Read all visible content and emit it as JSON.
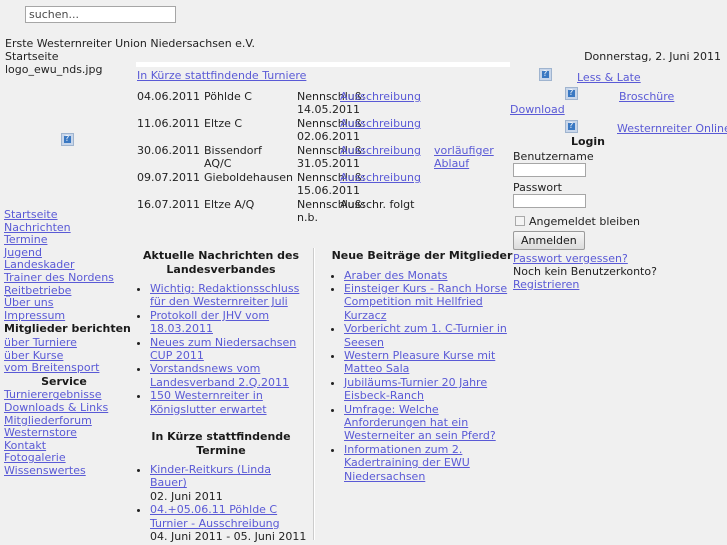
{
  "search": {
    "placeholder": "suchen...",
    "value": ""
  },
  "header": {
    "org_name": "Erste Westernreiter Union Niedersachsen e.V.",
    "breadcrumb": "Startseite",
    "logo_alt": "logo_ewu_nds.jpg",
    "date": "Donnerstag, 2. Juni 2011"
  },
  "tournaments": {
    "heading_link": "In Kürze stattfindende Turniere",
    "rows": [
      {
        "date": "04.06.2011",
        "place": "Pöhlde C",
        "nenn_label": "Nennschluß:",
        "nenn_date": "14.05.2011",
        "doc": "Ausschreibung",
        "extra": ""
      },
      {
        "date": "11.06.2011",
        "place": "Eltze C",
        "nenn_label": "Nennschluß:",
        "nenn_date": "02.06.2011",
        "doc": "Ausschreibung",
        "extra": ""
      },
      {
        "date": "30.06.2011",
        "place": "Bissendorf AQ/C",
        "nenn_label": "Nennschluß:",
        "nenn_date": "31.05.2011",
        "doc": "Ausschreibung",
        "extra": "vorläufiger Ablauf"
      },
      {
        "date": "09.07.2011",
        "place": "Gieboldehausen",
        "nenn_label": "Nennschluß:",
        "nenn_date": "15.06.2011",
        "doc": "Ausschreibung",
        "extra": ""
      },
      {
        "date": "16.07.2011",
        "place": "Eltze A/Q",
        "nenn_label": "Nennschluß:",
        "nenn_date": "n.b.",
        "doc": "Ausschr. folgt",
        "extra": ""
      }
    ]
  },
  "sidebar": {
    "items": [
      {
        "label": "Startseite",
        "type": "link"
      },
      {
        "label": "Nachrichten",
        "type": "link"
      },
      {
        "label": "Termine",
        "type": "link"
      },
      {
        "label": "Jugend",
        "type": "link"
      },
      {
        "label": "Landeskader",
        "type": "link"
      },
      {
        "label": "Trainer des Nordens",
        "type": "link"
      },
      {
        "label": "Reitbetriebe",
        "type": "link"
      },
      {
        "label": "Über uns",
        "type": "link"
      },
      {
        "label": "Impressum",
        "type": "link"
      },
      {
        "label": "Mitglieder berichten",
        "type": "header"
      },
      {
        "label": "über Turniere",
        "type": "link"
      },
      {
        "label": "über Kurse",
        "type": "link"
      },
      {
        "label": "vom Breitensport",
        "type": "link"
      },
      {
        "label": "Service",
        "type": "header-center"
      },
      {
        "label": "Turnierergebnisse",
        "type": "link"
      },
      {
        "label": "Downloads & Links",
        "type": "link"
      },
      {
        "label": "Mitgliederforum",
        "type": "link"
      },
      {
        "label": "Westernstore",
        "type": "link"
      },
      {
        "label": "Kontakt",
        "type": "link"
      },
      {
        "label": "Fotogalerie",
        "type": "link"
      },
      {
        "label": "Wissenswertes",
        "type": "link"
      }
    ]
  },
  "news_left": {
    "heading": "Aktuelle Nachrichten des Landesverbandes",
    "items": [
      "Wichtig: Redaktionsschluss für den Westernreiter Juli",
      "Protokoll der JHV vom 18.03.2011",
      "Neues zum Niedersachsen CUP 2011",
      "Vorstandsnews vom Landesverband 2.Q.2011",
      "150 Westernreiter in Königslutter erwartet"
    ]
  },
  "termine": {
    "heading": "In Kürze stattfindende Termine",
    "items": [
      {
        "title": "Kinder-Reitkurs (Linda Bauer)",
        "when": "02. Juni 2011"
      },
      {
        "title": "04.+05.06.11 Pöhlde C Turnier - Ausschreibung",
        "when": "04. Juni 2011 - 05. Juni 2011"
      }
    ]
  },
  "news_right": {
    "heading": "Neue Beiträge der Mitglieder",
    "items": [
      "Araber des Monats",
      "Einsteiger Kurs - Ranch Horse Competition mit Hellfried Kurzacz",
      "Vorbericht zum 1. C-Turnier in Seesen",
      "Western Pleasure Kurse mit Matteo Sala",
      "Jubiläums-Turnier 20 Jahre Eisbeck-Ranch",
      "Umfrage: Welche Anforderungen hat ein Westerneiter an sein Pferd?",
      "Informationen zum 2. Kadertraining der EWU Niedersachsen"
    ]
  },
  "banners": {
    "link1": "Less & Late",
    "link2": "Broschüre",
    "download": "Download",
    "link3": "Westernreiter Online"
  },
  "login": {
    "heading": "Login",
    "username_label": "Benutzername",
    "username_value": "",
    "password_label": "Passwort",
    "password_value": "",
    "remember_label": "Angemeldet bleiben",
    "submit_label": "Anmelden",
    "forgot_label": "Passwort vergessen?",
    "no_account_text": "Noch kein Benutzerkonto?",
    "register_label": "Registrieren"
  },
  "colors": {
    "link": "#5a5ad6",
    "background": "#f0f0f0",
    "text": "#222222"
  }
}
